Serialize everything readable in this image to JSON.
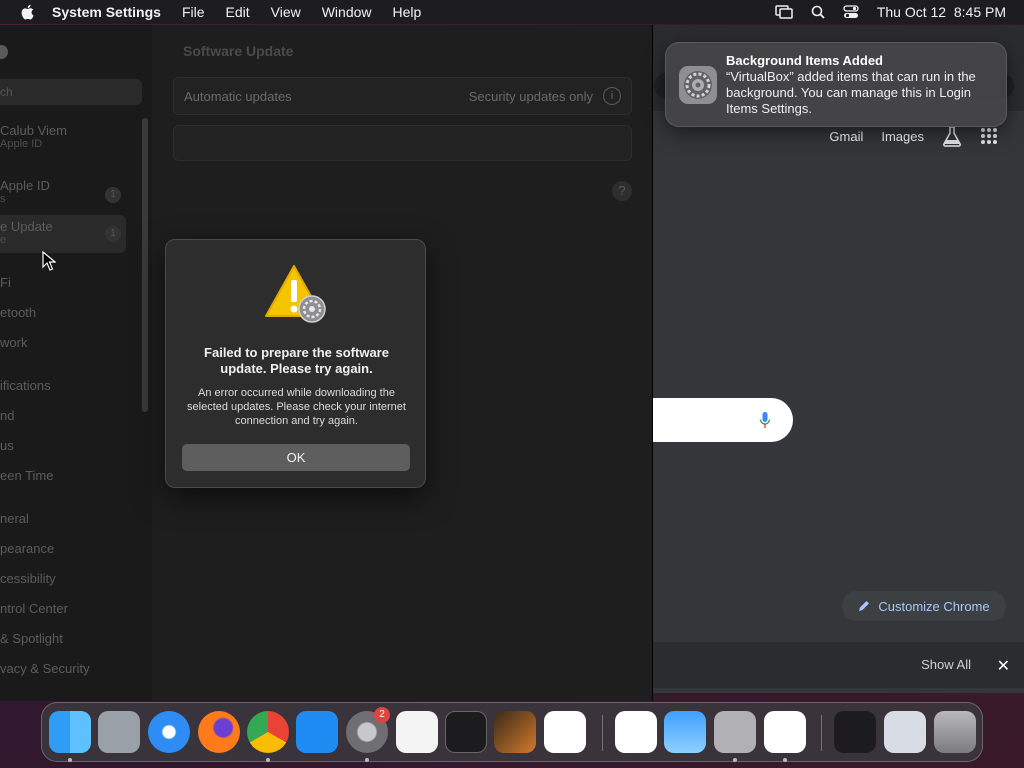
{
  "menubar": {
    "app_name": "System Settings",
    "menus": [
      "File",
      "Edit",
      "View",
      "Window",
      "Help"
    ],
    "datetime": "Thu Oct 12  8:45 PM"
  },
  "sidebar": {
    "search_placeholder": "ch",
    "items": [
      {
        "label": "Calub Viem",
        "sub": "Apple ID"
      },
      {
        "label": "Apple ID",
        "sub": "s",
        "badge": "1"
      },
      {
        "label": "e Update",
        "sub": "e",
        "badge": "1"
      },
      {
        "label": "Fi"
      },
      {
        "label": "etooth"
      },
      {
        "label": "work"
      },
      {
        "label": "ifications"
      },
      {
        "label": "nd"
      },
      {
        "label": "us"
      },
      {
        "label": "een Time"
      },
      {
        "label": "neral"
      },
      {
        "label": "pearance"
      },
      {
        "label": "cessibility"
      },
      {
        "label": "ntrol Center"
      },
      {
        "label": "& Spotlight"
      },
      {
        "label": "vacy & Security"
      }
    ]
  },
  "main": {
    "title": "Software Update",
    "auto_updates_label": "Automatic updates",
    "auto_updates_value": "Security updates only",
    "info_glyph": "i",
    "help_glyph": "?"
  },
  "alert": {
    "title": "Failed to prepare the software update. Please try again.",
    "message": "An error occurred while downloading the selected updates. Please check your internet connection and try again.",
    "ok_label": "OK"
  },
  "notification": {
    "title": "Background Items Added",
    "body": "“VirtualBox” added items that can run in the background. You can manage this in Login Items Settings."
  },
  "chrome": {
    "links": [
      "Gmail",
      "Images"
    ],
    "customize_label": "Customize Chrome",
    "show_all_label": "Show All",
    "close_glyph": "✕"
  },
  "dock": {
    "settings_badge": "2"
  }
}
